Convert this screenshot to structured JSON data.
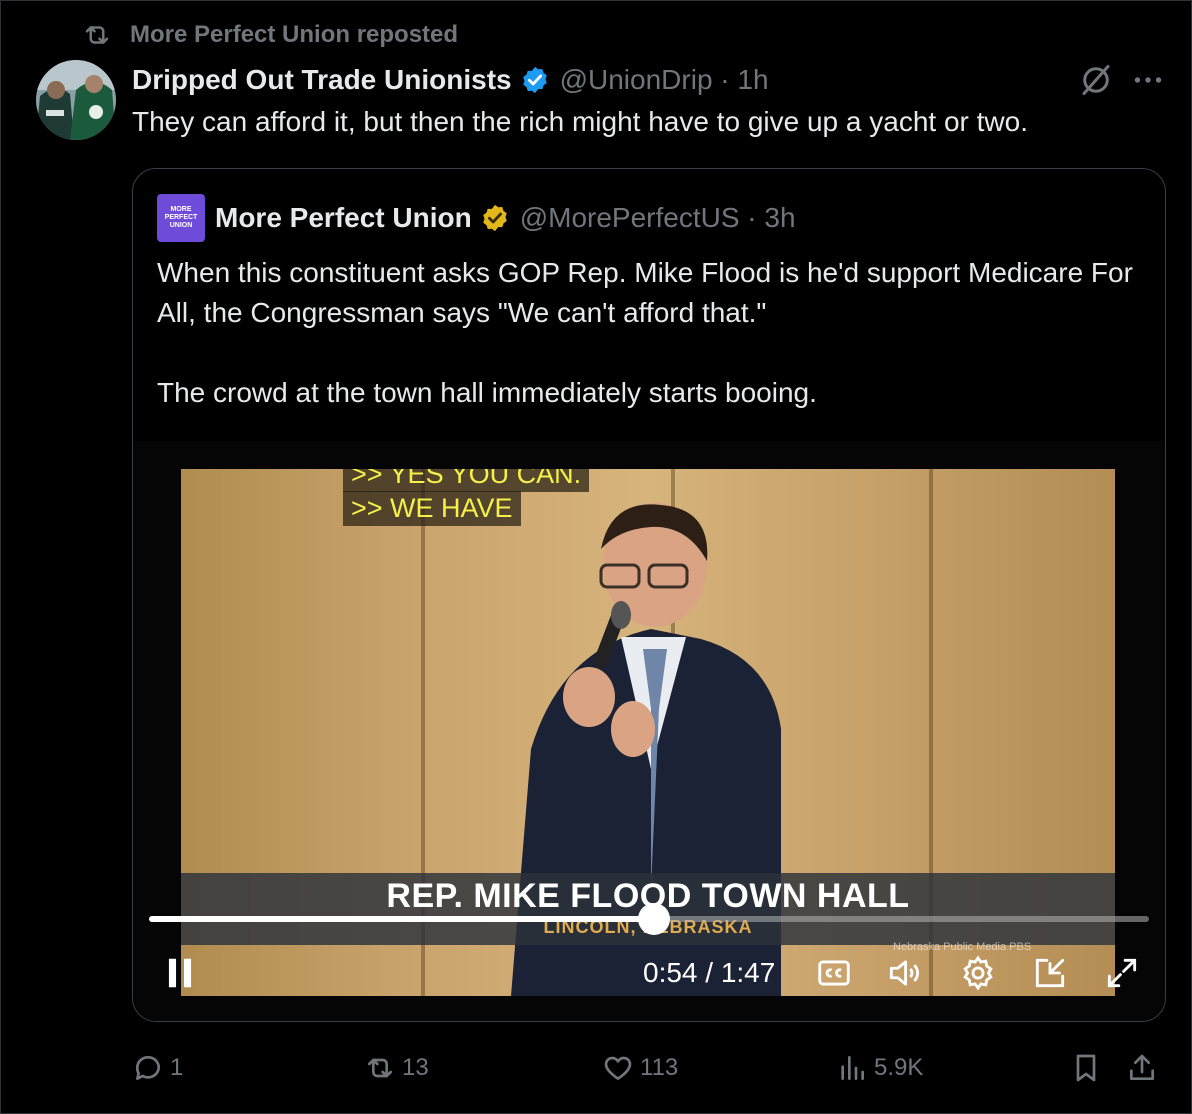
{
  "repost": {
    "text": "More Perfect Union reposted"
  },
  "post": {
    "author_name": "Dripped Out Trade Unionists",
    "handle_time": "@UnionDrip · 1h",
    "text": "They can afford it, but then the rich might have to give up a yacht or two."
  },
  "quote": {
    "logo_lines": [
      "MORE",
      "PERFECT",
      "UNION"
    ],
    "author_name": "More Perfect Union",
    "handle_time": "@MorePerfectUS · 3h",
    "text": "When this constituent asks GOP Rep. Mike Flood is he'd support Medicare For All, the Congressman says \"We can't afford that.\"\n\nThe crowd at the town hall immediately starts booing."
  },
  "video": {
    "caption_line_1": ">> YES YOU CAN.",
    "caption_line_2": ">> WE HAVE",
    "lower_third_title": "REP. MIKE FLOOD TOWN HALL",
    "lower_third_subtitle": "LINCOLN, NEBRASKA",
    "watermark": "Nebraska Public Media  PBS",
    "time_display": "0:54 / 1:47",
    "progress": 0.505
  },
  "actions": {
    "replies": "1",
    "reposts": "13",
    "likes": "113",
    "views": "5.9K"
  },
  "colors": {
    "background": "#000000",
    "text": "#e7e9ea",
    "muted": "#71767b",
    "verified_blue": "#1d9bf0",
    "verified_gold": "#e2b719",
    "border": "#2f3336"
  }
}
